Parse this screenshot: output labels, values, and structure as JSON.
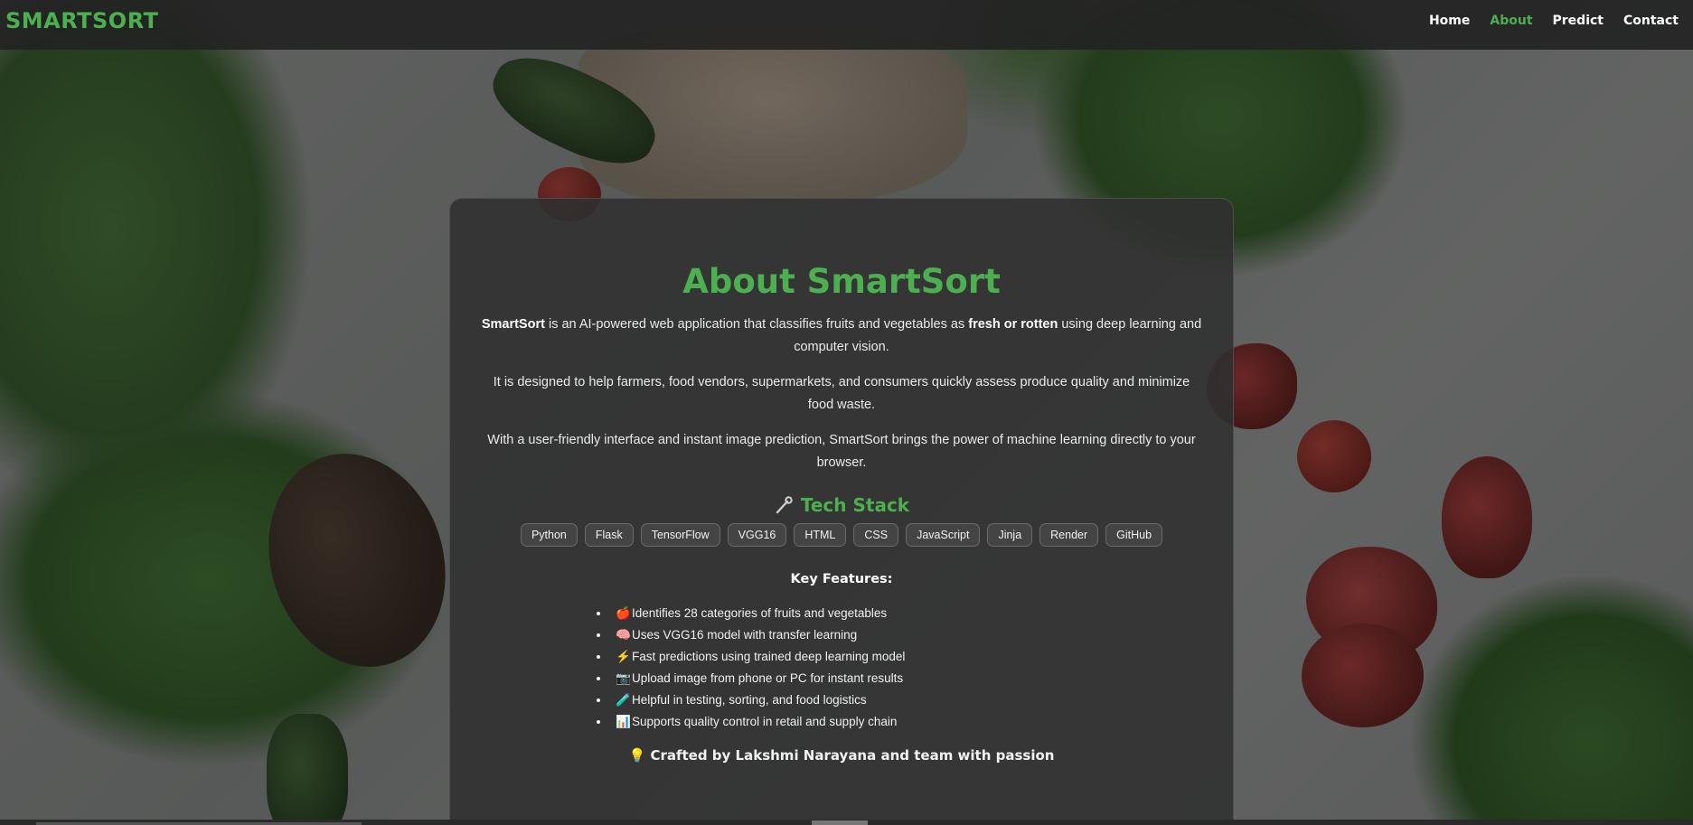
{
  "nav": {
    "brand": "SMARTSORT",
    "links": [
      {
        "label": "Home",
        "active": false
      },
      {
        "label": "About",
        "active": true
      },
      {
        "label": "Predict",
        "active": false
      },
      {
        "label": "Contact",
        "active": false
      }
    ]
  },
  "about": {
    "title": "About SmartSort",
    "para1_a": "SmartSort",
    "para1_b": " is an AI-powered web application that classifies fruits and vegetables as ",
    "para1_c": "fresh or rotten",
    "para1_d": " using deep learning and computer vision.",
    "para2": "It is designed to help farmers, food vendors, supermarkets, and consumers quickly assess produce quality and minimize food waste.",
    "para3": "With a user-friendly interface and instant image prediction, SmartSort brings the power of machine learning directly to your browser."
  },
  "tech": {
    "icon": "wrench-icon",
    "title": "Tech Stack",
    "items": [
      "Python",
      "Flask",
      "TensorFlow",
      "VGG16",
      "HTML",
      "CSS",
      "JavaScript",
      "Jinja",
      "Render",
      "GitHub"
    ]
  },
  "features": {
    "title": "Key Features:",
    "items": [
      {
        "icon": "🍎",
        "icon_name": "apple-icon",
        "text": "Identifies 28 categories of fruits and vegetables"
      },
      {
        "icon": "🧠",
        "icon_name": "brain-icon",
        "text": "Uses VGG16 model with transfer learning"
      },
      {
        "icon": "⚡",
        "icon_name": "lightning-icon",
        "text": "Fast predictions using trained deep learning model"
      },
      {
        "icon": "📷",
        "icon_name": "camera-icon",
        "text": "Upload image from phone or PC for instant results"
      },
      {
        "icon": "🧪",
        "icon_name": "test-tube-icon",
        "text": "Helpful in testing, sorting, and food logistics"
      },
      {
        "icon": "📊",
        "icon_name": "bar-chart-icon",
        "text": "Supports quality control in retail and supply chain"
      }
    ]
  },
  "credit": {
    "icon": "💡",
    "prefix": "Crafted by ",
    "name": "Lakshmi Narayana",
    "suffix": " and team with passion"
  },
  "colors": {
    "accent": "#4caf50",
    "navbar": "#232323",
    "card": "#303030"
  }
}
